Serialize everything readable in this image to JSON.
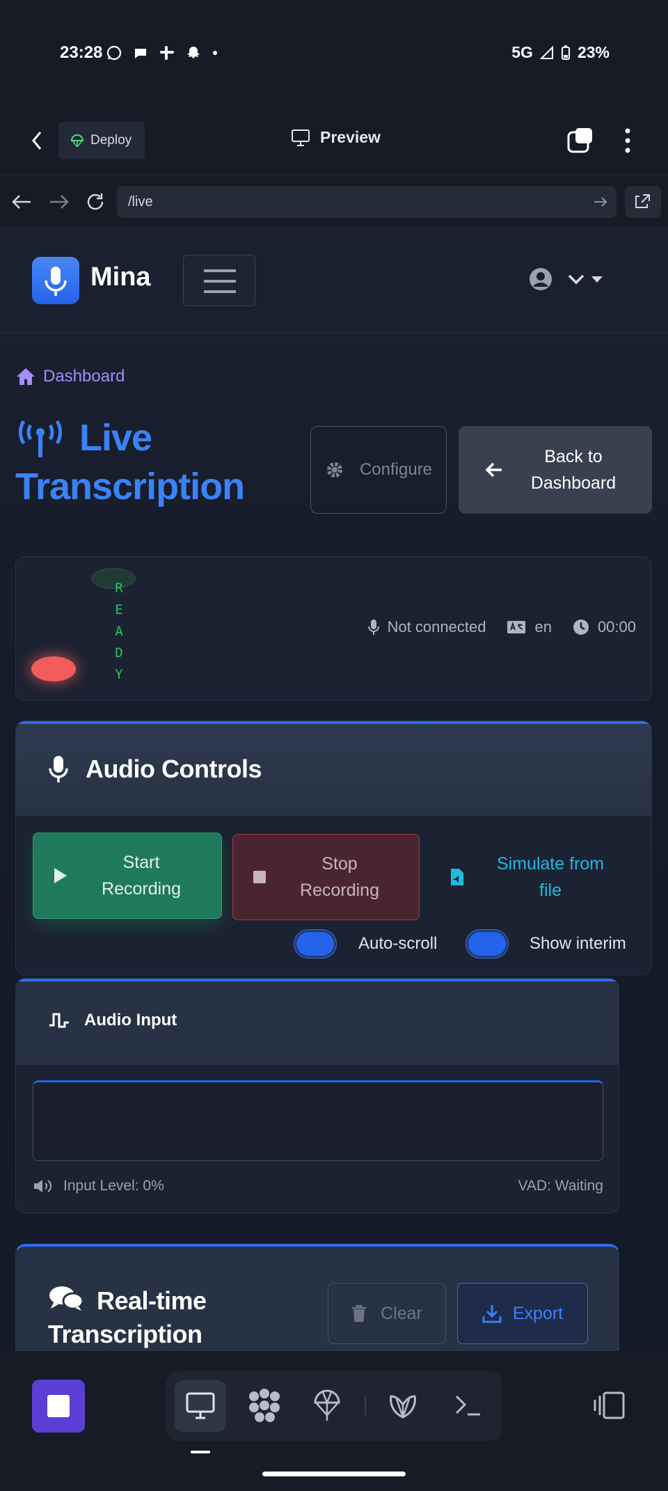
{
  "status_bar": {
    "time": "23:28",
    "network": "5G",
    "battery": "23%"
  },
  "app_header": {
    "deploy_label": "Deploy",
    "preview_label": "Preview"
  },
  "url_bar": {
    "url": "/live"
  },
  "nav": {
    "brand": "Mina"
  },
  "breadcrumb": {
    "label": "Dashboard"
  },
  "page": {
    "title": "Live Transcription",
    "configure_label": "Configure",
    "back_label": "Back to Dashboard"
  },
  "status": {
    "ready_letters": [
      "R",
      "E",
      "A",
      "D",
      "Y"
    ],
    "connection": "Not connected",
    "language": "en",
    "duration": "00:00"
  },
  "audio_controls": {
    "title": "Audio Controls",
    "start_label": "Start Recording",
    "stop_label": "Stop Recording",
    "simulate_label": "Simulate from file",
    "autoscroll_label": "Auto-scroll",
    "autoscroll_on": true,
    "show_interim_label": "Show interim",
    "show_interim_on": true
  },
  "audio_input": {
    "title": "Audio Input",
    "level_label": "Input Level: 0%",
    "vad_label": "VAD: Waiting"
  },
  "transcription": {
    "title": "Real-time Transcription",
    "clear_label": "Clear",
    "export_label": "Export"
  },
  "colors": {
    "accent": "#3b82f6",
    "success": "#1f7a5c",
    "danger": "#f25c5c",
    "purple": "#a78bfa"
  }
}
